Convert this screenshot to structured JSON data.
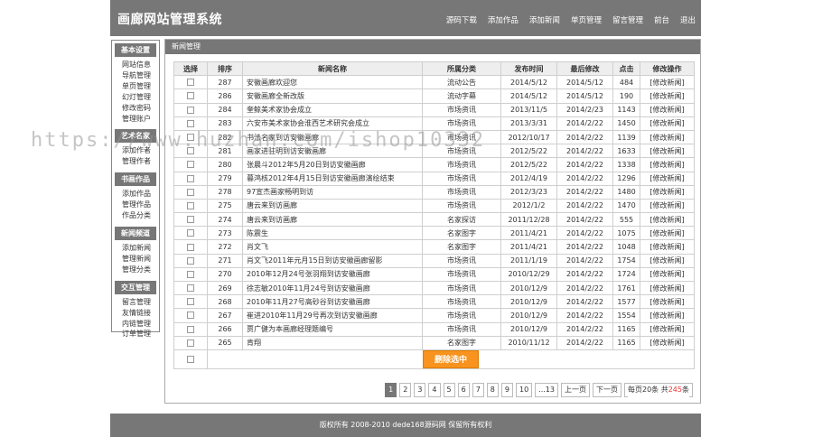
{
  "header": {
    "title": "画廊网站管理系统",
    "nav": [
      "源码下载",
      "添加作品",
      "添加新闻",
      "单页管理",
      "留言管理",
      "前台",
      "退出"
    ]
  },
  "sidebar": {
    "groups": [
      {
        "title": "基本设置",
        "items": [
          "网站信息",
          "导航管理",
          "单页管理",
          "幻灯管理",
          "修改密码",
          "管理账户"
        ]
      },
      {
        "title": "艺术名家",
        "items": [
          "添加作者",
          "管理作者"
        ]
      },
      {
        "title": "书画作品",
        "items": [
          "添加作品",
          "管理作品",
          "作品分类"
        ]
      },
      {
        "title": "新闻频道",
        "items": [
          "添加新闻",
          "管理新闻",
          "管理分类"
        ]
      },
      {
        "title": "交互管理",
        "items": [
          "留言管理",
          "友情链接",
          "内链管理",
          "订单管理"
        ]
      }
    ]
  },
  "panel": {
    "title": "新闻管理"
  },
  "table": {
    "headers": [
      "选择",
      "排序",
      "新闻名称",
      "所属分类",
      "发布时间",
      "最后修改",
      "点击",
      "修改操作"
    ],
    "rows": [
      [
        "287",
        "安徽画廊欢迎您",
        "流动公告",
        "2014/5/12",
        "2014/5/12",
        "484",
        "[修改新闻]"
      ],
      [
        "286",
        "安徽画廊全新改版",
        "流动字幕",
        "2014/5/12",
        "2014/5/12",
        "190",
        "[修改新闻]"
      ],
      [
        "284",
        "奎鲸美术家协会成立",
        "市场资讯",
        "2013/11/5",
        "2014/2/23",
        "1143",
        "[修改新闻]"
      ],
      [
        "283",
        "六安市美术家协会淮西艺术研究会成立",
        "市场资讯",
        "2013/3/31",
        "2014/2/22",
        "1450",
        "[修改新闻]"
      ],
      [
        "282",
        "书法名家到访安徽画廊",
        "市场资讯",
        "2012/10/17",
        "2014/2/22",
        "1139",
        "[修改新闻]"
      ],
      [
        "281",
        "画家进驻明到访安徽画廊",
        "市场资讯",
        "2012/5/22",
        "2014/2/22",
        "1633",
        "[修改新闻]"
      ],
      [
        "280",
        "张晨斗2012年5月20日到访安徽画廊",
        "市场资讯",
        "2012/5/22",
        "2014/2/22",
        "1338",
        "[修改新闻]"
      ],
      [
        "279",
        "暮鸿核2012年4月15日到访安徽画廊演绘结束",
        "市场资讯",
        "2012/4/19",
        "2014/2/22",
        "1296",
        "[修改新闻]"
      ],
      [
        "278",
        "97宣杰画家畅明到访",
        "市场资讯",
        "2012/3/23",
        "2014/2/22",
        "1480",
        "[修改新闻]"
      ],
      [
        "275",
        "唐云来到访画廊",
        "市场资讯",
        "2012/1/2",
        "2014/2/22",
        "1470",
        "[修改新闻]"
      ],
      [
        "274",
        "唐云来到访画廊",
        "名家探访",
        "2011/12/28",
        "2014/2/22",
        "555",
        "[修改新闻]"
      ],
      [
        "273",
        "陈震生",
        "名家图字",
        "2011/4/21",
        "2014/2/22",
        "1075",
        "[修改新闻]"
      ],
      [
        "272",
        "肖文飞",
        "名家图字",
        "2011/4/21",
        "2014/2/22",
        "1048",
        "[修改新闻]"
      ],
      [
        "271",
        "肖文飞2011年元月15日到访安徽画廊留影",
        "市场资讯",
        "2011/1/19",
        "2014/2/22",
        "1754",
        "[修改新闻]"
      ],
      [
        "270",
        "2010年12月24号张羽翔到访安徽画廊",
        "市场资讯",
        "2010/12/29",
        "2014/2/22",
        "1724",
        "[修改新闻]"
      ],
      [
        "269",
        "徐志敏2010年11月24号到访安徽画廊",
        "市场资讯",
        "2010/12/9",
        "2014/2/22",
        "1761",
        "[修改新闻]"
      ],
      [
        "268",
        "2010年11月27号高砂谷到访安徽画廊",
        "市场资讯",
        "2010/12/9",
        "2014/2/22",
        "1577",
        "[修改新闻]"
      ],
      [
        "267",
        "崔进2010年11月29号再次到访安徽画廊",
        "市场资讯",
        "2010/12/9",
        "2014/2/22",
        "1554",
        "[修改新闻]"
      ],
      [
        "266",
        "贾广健为本画廊经理题编号",
        "市场资讯",
        "2010/12/9",
        "2014/2/22",
        "1165",
        "[修改新闻]"
      ],
      [
        "265",
        "肯翔",
        "名家图字",
        "2010/11/12",
        "2014/2/22",
        "1165",
        "[修改新闻]"
      ]
    ],
    "delete_label": "删除选中"
  },
  "pager": {
    "pages": [
      "1",
      "2",
      "3",
      "4",
      "5",
      "6",
      "7",
      "8",
      "9",
      "10",
      "...13"
    ],
    "current": "1",
    "prev": "上一页",
    "next": "下一页",
    "per_page_prefix": "每页20条 共",
    "total": "245",
    "per_page_suffix": "条"
  },
  "footer": {
    "text": "版权所有 2008-2010 dede168源码网 保留所有权利"
  },
  "watermark": {
    "text": "https://www.huzhan.com/ishop10332"
  }
}
